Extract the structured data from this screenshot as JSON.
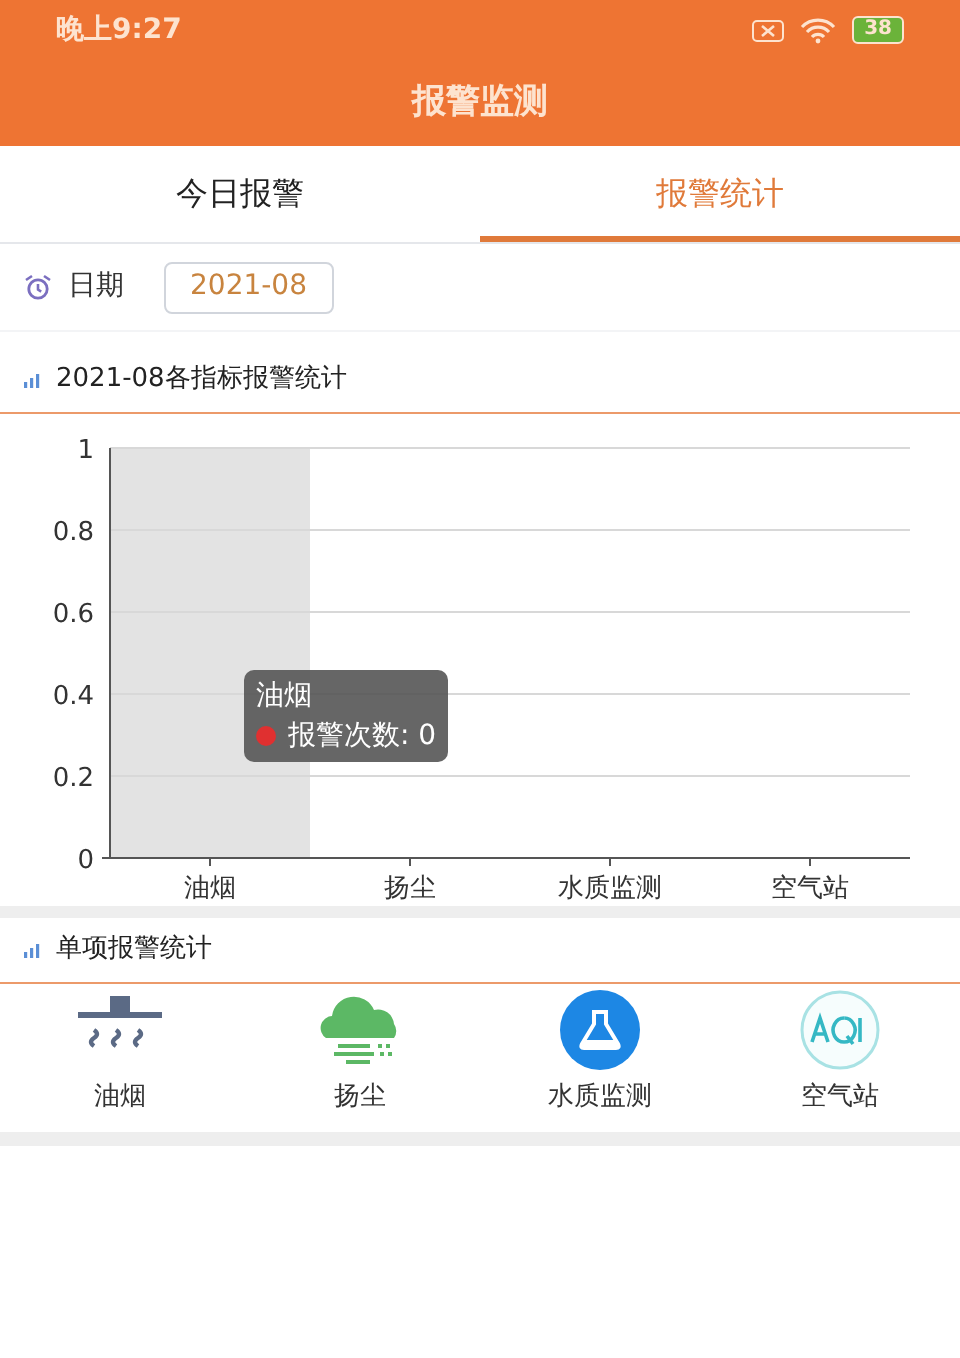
{
  "status_bar": {
    "time": "晚上9:27",
    "battery": "38"
  },
  "header": {
    "title": "报警监测"
  },
  "tabs": [
    {
      "label": "今日报警",
      "selected": false
    },
    {
      "label": "报警统计",
      "selected": true
    }
  ],
  "date_filter": {
    "label": "日期",
    "value": "2021-08"
  },
  "chart_section": {
    "title": "2021-08各指标报警统计",
    "chart_data": {
      "type": "bar",
      "categories": [
        "油烟",
        "扬尘",
        "水质监测",
        "空气站"
      ],
      "series": [
        {
          "name": "报警次数",
          "color": "#e03030",
          "values": [
            0,
            0,
            0,
            0
          ]
        }
      ],
      "ylim": [
        0,
        1
      ],
      "yticks": [
        0,
        0.2,
        0.4,
        0.6,
        0.8,
        {
          "value": 1,
          "label": "1"
        }
      ],
      "grid": true,
      "bands": [
        {
          "axis": "x",
          "from": "油烟",
          "to": "油烟",
          "color": "#e3e3e3"
        }
      ]
    },
    "tooltip": {
      "title": "油烟",
      "separator": ":",
      "value": "0"
    }
  },
  "items_section": {
    "title": "单项报警统计",
    "items": [
      {
        "kind": "smoke",
        "label": "油烟"
      },
      {
        "kind": "dust",
        "label": "扬尘"
      },
      {
        "kind": "water",
        "label": "水质监测"
      },
      {
        "kind": "air",
        "label": "空气站"
      }
    ]
  }
}
